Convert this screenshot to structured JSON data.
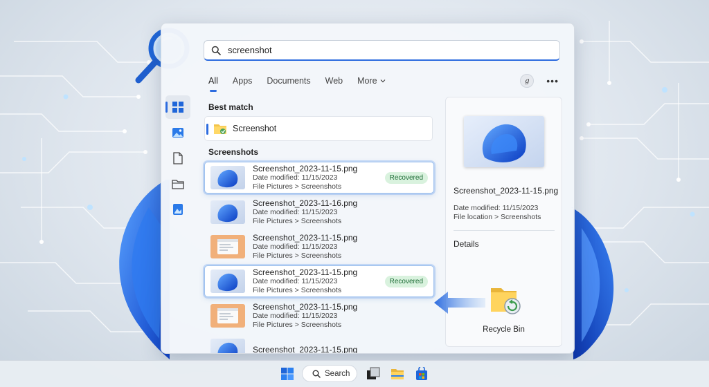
{
  "search": {
    "query": "screenshot"
  },
  "tabs": [
    {
      "label": "All"
    },
    {
      "label": "Apps"
    },
    {
      "label": "Documents"
    },
    {
      "label": "Web"
    },
    {
      "label": "More"
    }
  ],
  "sections": {
    "best_match": "Best match",
    "screenshots": "Screenshots"
  },
  "best_match": {
    "name": "Screenshot"
  },
  "results": [
    {
      "name": "Screenshot_2023-11-15.png",
      "date": "Date modified: 11/15/2023",
      "location": "File Pictures > Screenshots",
      "badge": "Recovered",
      "thumb": "bloom"
    },
    {
      "name": "Screenshot_2023-11-16.png",
      "date": "Date modified: 11/15/2023",
      "location": "File Pictures > Screenshots",
      "badge": "",
      "thumb": "bloom"
    },
    {
      "name": "Screenshot_2023-11-15.png",
      "date": "Date modified: 11/15/2023",
      "location": "File Pictures > Screenshots",
      "badge": "",
      "thumb": "window"
    },
    {
      "name": "Screenshot_2023-11-15.png",
      "date": "Date modified: 11/15/2023",
      "location": "File Pictures > Screenshots",
      "badge": "Recovered",
      "thumb": "bloom"
    },
    {
      "name": "Screenshot_2023-11-15.png",
      "date": "Date modified: 11/15/2023",
      "location": "File Pictures > Screenshots",
      "badge": "",
      "thumb": "window"
    },
    {
      "name": "Screenshot_2023-11-15.png",
      "date": "",
      "location": "",
      "badge": "",
      "thumb": "bloom"
    }
  ],
  "preview": {
    "title": "Screenshot_2023-11-15.png",
    "date": "Date modified: 11/15/2023",
    "location": "File location > Screenshots",
    "details_label": "Details",
    "recycle_bin_label": "Recycle Bin"
  },
  "taskbar": {
    "search_label": "Search"
  },
  "icons": {
    "search": "search-icon",
    "magnifier": "magnifier-icon",
    "folder": "folder-icon",
    "recycle": "recycle-bin-icon",
    "windows": "windows-logo-icon"
  },
  "colors": {
    "accent": "#2d6cdf",
    "badge_bg": "#d9f2de",
    "badge_text": "#1b6b34"
  }
}
